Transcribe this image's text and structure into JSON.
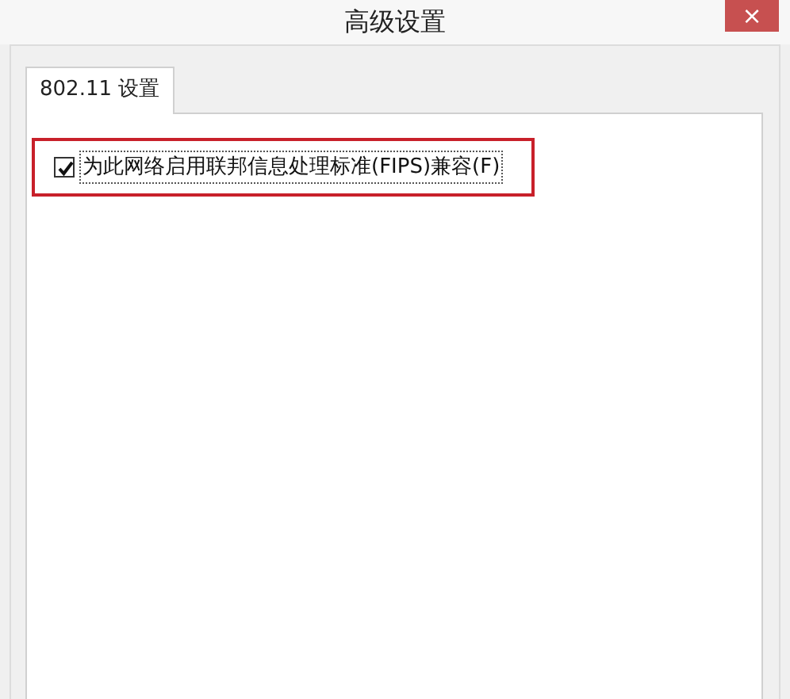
{
  "window": {
    "title": "高级设置",
    "close_glyph": "×"
  },
  "tabs": [
    {
      "label": "802.11 设置",
      "selected": true
    }
  ],
  "options": [
    {
      "label": "为此网络启用联邦信息处理标准(FIPS)兼容(F)",
      "checked": true,
      "highlighted": true
    }
  ]
}
